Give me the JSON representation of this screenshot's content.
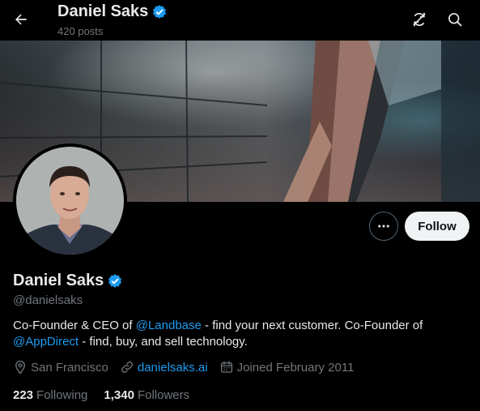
{
  "header": {
    "name": "Daniel Saks",
    "posts_count": "420 posts"
  },
  "profile": {
    "name": "Daniel Saks",
    "handle": "@danielsaks",
    "verified": true,
    "follow_label": "Follow",
    "bio": {
      "p1": "Co-Founder & CEO of ",
      "mention1": "@Landbase",
      "p2": " - find your next customer.  Co-Founder of ",
      "mention2": "@AppDirect",
      "p3": " -  find, buy, and sell technology."
    },
    "location": "San Francisco",
    "website": "danielsaks.ai",
    "joined": "Joined February 2011",
    "following_count": "223",
    "following_label": "Following",
    "followers_count": "1,340",
    "followers_label": "Followers"
  },
  "icons": {
    "back": "arrow-left-icon",
    "refresh": "refresh-icon",
    "search": "search-icon",
    "more": "more-icon",
    "verified": "verified-badge-icon",
    "location": "location-pin-icon",
    "link": "link-icon",
    "calendar": "calendar-icon"
  },
  "colors": {
    "background": "#000000",
    "accent": "#1d9bf0",
    "secondary_text": "#71767b",
    "primary_text": "#e7e9ea",
    "follow_button": "#eff3f4"
  }
}
